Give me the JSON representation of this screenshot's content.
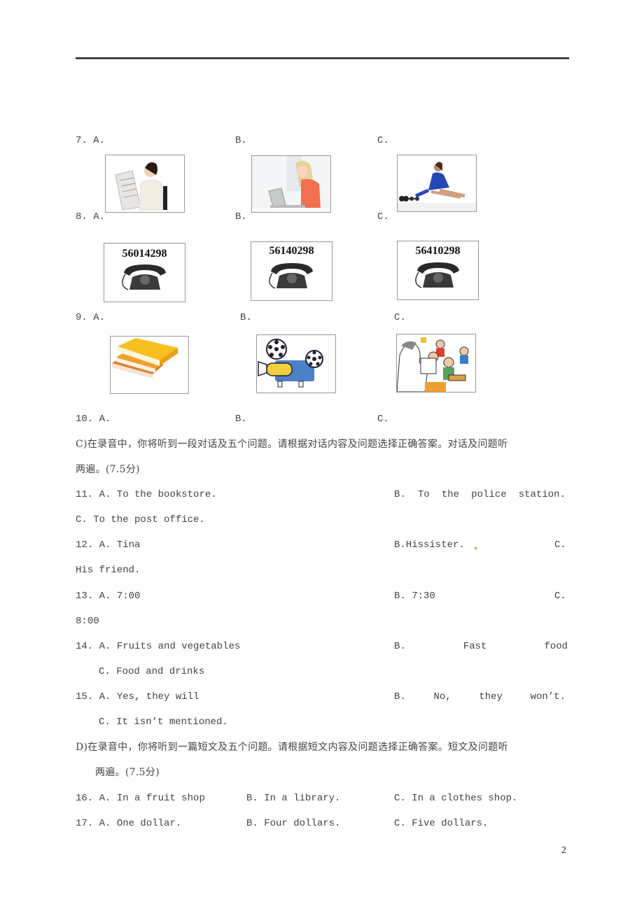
{
  "questions_pictures": [
    {
      "number": "7.",
      "options": [
        {
          "label": "A.",
          "image": "woman-reading-newspaper"
        },
        {
          "label": "B.",
          "image": "woman-using-laptop"
        },
        {
          "label": "C.",
          "image": "woman-stretching-with-dumbbells"
        }
      ]
    },
    {
      "number": "8.",
      "options": [
        {
          "label": "A.",
          "image": "telephone",
          "phone_number": "56014298"
        },
        {
          "label": "B.",
          "image": "telephone",
          "phone_number": "56140298"
        },
        {
          "label": "C.",
          "image": "telephone",
          "phone_number": "56410298"
        }
      ]
    },
    {
      "number": "9.",
      "options": [
        {
          "label": "A.",
          "image": "stack-of-books"
        },
        {
          "label": "B.",
          "image": "film-projector"
        },
        {
          "label": "C.",
          "image": "teacher-with-classroom"
        }
      ]
    },
    {
      "number": "10.",
      "options": [
        {
          "label": "A."
        },
        {
          "label": "B."
        },
        {
          "label": "C."
        }
      ]
    }
  ],
  "section_c": {
    "instruction_line1": "C)在录音中，你将听到一段对话及五个问题。请根据对话内容及问题选择正确答案。对话及问题听",
    "instruction_line2": "两遍。(7.5分)"
  },
  "section_c_questions": [
    {
      "number": "11.",
      "a": "A. To the bookstore.",
      "b_parts": [
        "B.",
        "To",
        "the",
        "police",
        "station."
      ],
      "c": "C. To the post office."
    },
    {
      "number": "12.",
      "a": "A. Tina",
      "b": "B.Hissister.",
      "c_label": "C.",
      "c": "His friend."
    },
    {
      "number": "13.",
      "a": "A. 7:00",
      "b": "B. 7:30",
      "c_label": "C.",
      "c": "8:00"
    },
    {
      "number": "14.",
      "a": "A. Fruits and vegetables",
      "b_parts": [
        "B.",
        "Fast",
        "food"
      ],
      "c": "C. Food and drinks"
    },
    {
      "number": "15.",
      "a": "A. Yes, they will",
      "b_parts": [
        "B.",
        "No,",
        "they",
        "won’t."
      ],
      "c": "C. It isn’t mentioned."
    }
  ],
  "section_d": {
    "instruction_line1": "D)在录音中，你将听到一篇短文及五个问题。请根据短文内容及问题选择正确答案。短文及问题听",
    "instruction_line2": "两遍。(7.5分)"
  },
  "section_d_questions": [
    {
      "number": "16.",
      "a": "A. In a fruit shop",
      "b": "B. In a library.",
      "c": "C. In a clothes shop."
    },
    {
      "number": "17.",
      "a": "A. One dollar.",
      "b": "B. Four dollars.",
      "c": "C. Five dollars."
    }
  ],
  "page_number": "2"
}
